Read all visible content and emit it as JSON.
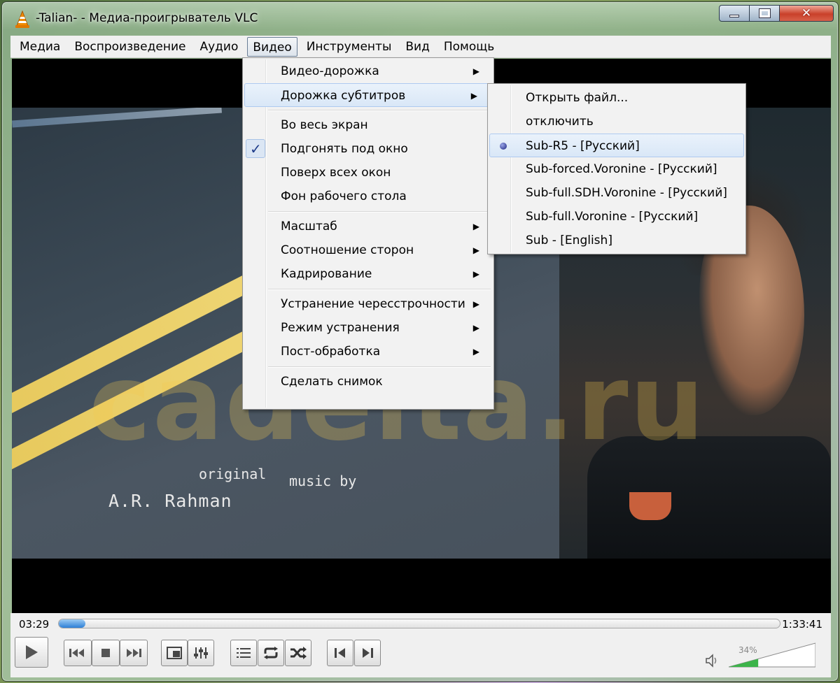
{
  "window": {
    "title": "-Talian- - Медиа-проигрыватель VLC",
    "close_symbol": "✕"
  },
  "menubar": {
    "items": [
      {
        "label": "Медиа"
      },
      {
        "label": "Воспроизведение"
      },
      {
        "label": "Аудио"
      },
      {
        "label": "Видео",
        "active": true
      },
      {
        "label": "Инструменты"
      },
      {
        "label": "Вид"
      },
      {
        "label": "Помощь"
      }
    ]
  },
  "video_menu": {
    "items": {
      "video_track": "Видео-дорожка",
      "subtitle_track": "Дорожка субтитров",
      "fullscreen": "Во весь экран",
      "fit_window": "Подгонять под окно",
      "always_on_top": "Поверх всех окон",
      "wallpaper": "Фон рабочего стола",
      "zoom": "Масштаб",
      "aspect_ratio": "Соотношение сторон",
      "crop": "Кадрирование",
      "deinterlace": "Устранение чересстрочности",
      "deinterlace_mode": "Режим устранения",
      "postprocessing": "Пост-обработка",
      "snapshot": "Сделать снимок"
    },
    "submenu_arrow": "▶",
    "checkmark": "✓"
  },
  "subtitle_submenu": {
    "items": {
      "open_file": "Открыть файл...",
      "disable": "отключить",
      "track_r5": "Sub-R5 - [Русский]",
      "track_forced": "Sub-forced.Voronine - [Русский]",
      "track_sdh": "Sub-full.SDH.Voronine - [Русский]",
      "track_full": "Sub-full.Voronine - [Русский]",
      "track_english": "Sub - [English]"
    },
    "selected": "track_r5"
  },
  "video": {
    "credit_line_1": "original",
    "credit_line_2": "music by",
    "credit_line_3": "A.R. Rahman",
    "watermark": "cadelta.ru"
  },
  "controls": {
    "time_current": "03:29",
    "time_total": "1:33:41",
    "progress_percent": 3.7,
    "volume_label": "34%",
    "volume_percent": 34,
    "icons": [
      "play-icon",
      "previous-icon",
      "stop-icon",
      "next-icon",
      "fullscreen-icon",
      "extended-settings-icon",
      "playlist-icon",
      "loop-icon",
      "shuffle-icon",
      "frame-back-icon",
      "frame-forward-icon",
      "volume-icon"
    ]
  },
  "colors": {
    "menu_highlight": "#d9e7f7",
    "progress_fill": "#2d7fd6",
    "volume_fill": "#3cb44a",
    "close_button": "#c9402a"
  }
}
